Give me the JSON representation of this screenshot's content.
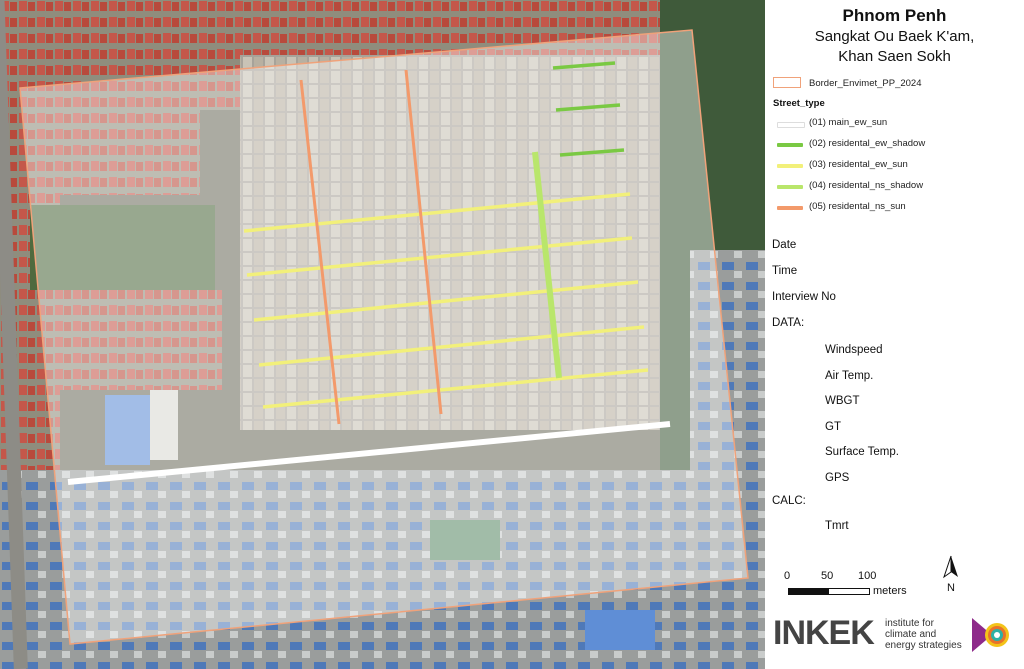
{
  "title": {
    "main": "Phnom Penh",
    "sub_line1": "Sangkat Ou Baek K'am,",
    "sub_line2": "Khan Saen Sokh"
  },
  "legend": {
    "border_label": "Border_Envimet_PP_2024",
    "street_type_header": "Street_type",
    "street_types": [
      {
        "label": "(01) main_ew_sun",
        "color": "#ffffff"
      },
      {
        "label": "(02) residental_ew_shadow",
        "color": "#7ac943"
      },
      {
        "label": "(03) residental_ew_sun",
        "color": "#f2f07a"
      },
      {
        "label": "(04) residental_ns_shadow",
        "color": "#b9e66b"
      },
      {
        "label": "(05) residental_ns_sun",
        "color": "#f39a6b"
      }
    ],
    "border_color": "#f0a27a"
  },
  "fields": {
    "date": "Date",
    "time": "Time",
    "interview": "Interview No",
    "data_header": "DATA:",
    "data_items": [
      "Windspeed",
      "Air Temp.",
      "WBGT",
      "GT",
      "Surface Temp.",
      "GPS"
    ],
    "calc_header": "CALC:",
    "calc_items": [
      "Tmrt"
    ]
  },
  "scale": {
    "ticks": [
      "0",
      "50",
      "100"
    ],
    "unit": "meters"
  },
  "north_label": "N",
  "branding": {
    "name": "INKEK",
    "tagline_line1": "institute for",
    "tagline_line2": "climate and",
    "tagline_line3": "energy strategies"
  }
}
